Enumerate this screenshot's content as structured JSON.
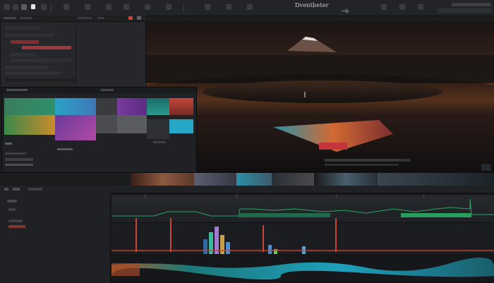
{
  "app": {
    "title": "Dventbeter",
    "mark": "ꟷb"
  },
  "colors": {
    "accent_red": "#c74634",
    "panel": "#26272a",
    "background": "#1b1c1e",
    "green_wave": "#2aa466",
    "cyan": "#1fb7d8"
  },
  "icons": [
    "record-icon",
    "play-icon",
    "settings-icon",
    "menu-icon",
    "search-icon",
    "close-icon"
  ]
}
